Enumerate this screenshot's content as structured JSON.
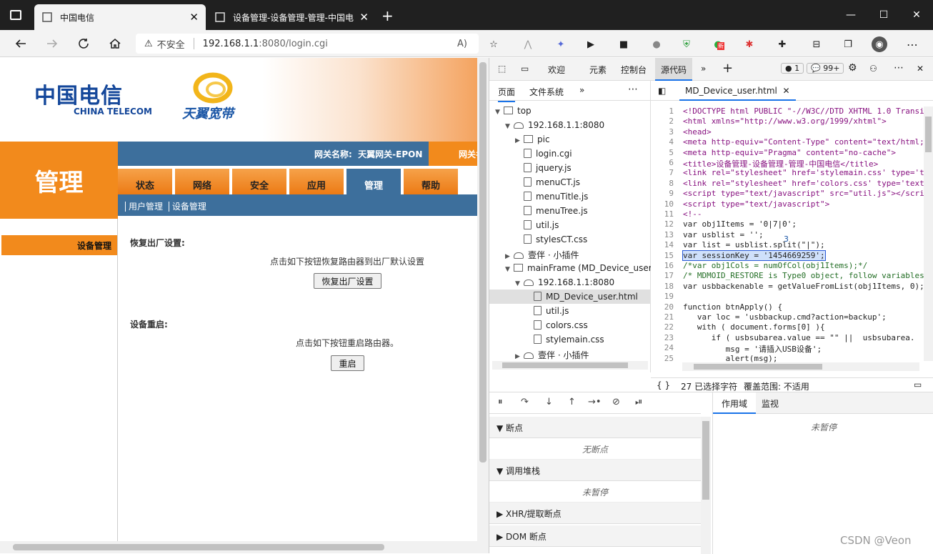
{
  "browser": {
    "tabs": [
      {
        "title": "中国电信"
      },
      {
        "title": "设备管理-设备管理-管理-中国电"
      }
    ],
    "new_tab": "+",
    "security_label": "不安全",
    "url_host": "192.168.1.1",
    "url_rest": ":8080/login.cgi",
    "window": {
      "minimize": "—",
      "maximize": "☐",
      "close": "✕"
    },
    "ext_badge": "新"
  },
  "page": {
    "logo_cn": "中国电信",
    "logo_en": "CHINA TELECOM",
    "logo2": "天翼宽带",
    "section_title": "管理",
    "gateway_label": "网关名称:",
    "gateway_name": "天翼网关-EPON",
    "gateway_label2": "网关名",
    "nav": [
      "状态",
      "网络",
      "安全",
      "应用",
      "管理",
      "帮助"
    ],
    "subnav": [
      "用户管理",
      "设备管理"
    ],
    "sidebar_item": "设备管理",
    "restore": {
      "label": "恢复出厂设置:",
      "note": "点击如下按钮恢复路由器到出厂默认设置",
      "button": "恢复出厂设置"
    },
    "reboot": {
      "label": "设备重启:",
      "note": "点击如下按钮重启路由器。",
      "button": "重启"
    }
  },
  "devtools": {
    "tabs": [
      "欢迎",
      "元素",
      "控制台",
      "源代码"
    ],
    "active_tab": "源代码",
    "errors": "1",
    "messages": "99+",
    "nav_tabs": [
      "页面",
      "文件系统"
    ],
    "tree": [
      {
        "label": "top",
        "level": 0,
        "kind": "frame",
        "open": true
      },
      {
        "label": "192.168.1.1:8080",
        "level": 1,
        "kind": "cloud",
        "open": true
      },
      {
        "label": "pic",
        "level": 2,
        "kind": "folder",
        "open": false
      },
      {
        "label": "login.cgi",
        "level": 2,
        "kind": "file"
      },
      {
        "label": "jquery.js",
        "level": 2,
        "kind": "file"
      },
      {
        "label": "menuCT.js",
        "level": 2,
        "kind": "file"
      },
      {
        "label": "menuTitle.js",
        "level": 2,
        "kind": "file"
      },
      {
        "label": "menuTree.js",
        "level": 2,
        "kind": "file"
      },
      {
        "label": "util.js",
        "level": 2,
        "kind": "file"
      },
      {
        "label": "stylesCT.css",
        "level": 2,
        "kind": "file"
      },
      {
        "label": "壹伴 · 小插件",
        "level": 1,
        "kind": "cloud",
        "open": false
      },
      {
        "label": "mainFrame (MD_Device_user.htm",
        "level": 1,
        "kind": "frame",
        "open": true
      },
      {
        "label": "192.168.1.1:8080",
        "level": 2,
        "kind": "cloud",
        "open": true
      },
      {
        "label": "MD_Device_user.html",
        "level": 3,
        "kind": "file",
        "selected": true
      },
      {
        "label": "util.js",
        "level": 3,
        "kind": "file"
      },
      {
        "label": "colors.css",
        "level": 3,
        "kind": "file"
      },
      {
        "label": "stylemain.css",
        "level": 3,
        "kind": "file"
      },
      {
        "label": "壹伴 · 小插件",
        "level": 2,
        "kind": "cloud",
        "open": false
      }
    ],
    "editor_tab": "MD_Device_user.html",
    "code": [
      "<!DOCTYPE html PUBLIC \"-//W3C//DTD XHTML 1.0 Transi",
      "<html xmlns=\"http://www.w3.org/1999/xhtml\">",
      "<head>",
      "<meta http-equiv=\"Content-Type\" content=\"text/html;",
      "<meta http-equiv=\"Pragma\" content=\"no-cache\">",
      "<title>设备管理-设备管理-管理-中国电信</title>",
      "<link rel=\"stylesheet\" href='stylemain.css' type='t",
      "<link rel=\"stylesheet\" href='colors.css' type='text",
      "<script type=\"text/javascript\" src=\"util.js\"></scri",
      "<script type=\"text/javascript\">",
      "<!--",
      "var obj1Items = '0|7|0';",
      "var usblist = '';",
      "var list = usblist.split(\"|\");",
      "var sessionKey = '1454669259';",
      "/*var obj1Cols = numOfCol(obj1Items);*/",
      "/* MDMOID_RESTORE is Type0 object, follow variables",
      "var usbbackenable = getValueFromList(obj1Items, 0);",
      "",
      "function btnApply() {",
      "   var loc = 'usbbackup.cmd?action=backup';",
      "   with ( document.forms[0] ){",
      "      if ( usbsubarea.value == \"\" ||  usbsubarea.",
      "         msg = '请插入USB设备';",
      "         alert(msg);"
    ],
    "selection_annot": "3",
    "status_braces": "{ }",
    "status_selected": "27 已选择字符",
    "status_coverage": "覆盖范围: 不适用",
    "debugger": {
      "sections": [
        {
          "title": "断点",
          "body": "无断点"
        },
        {
          "title": "调用堆栈",
          "body": "未暂停"
        },
        {
          "title": "XHR/提取断点",
          "body": ""
        },
        {
          "title": "DOM 断点",
          "body": ""
        }
      ],
      "scope_tabs": [
        "作用域",
        "监视"
      ],
      "scope_body": "未暂停"
    }
  },
  "watermark": "CSDN @Veon"
}
